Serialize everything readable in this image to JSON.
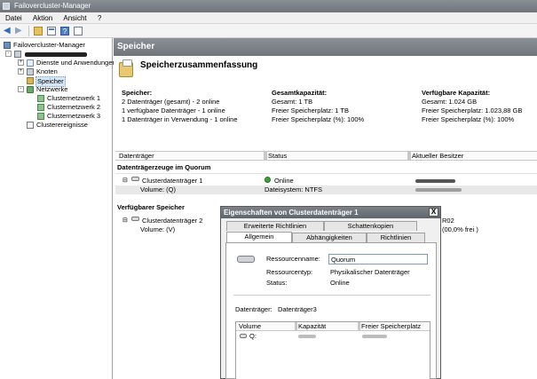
{
  "window": {
    "title": "Failovercluster-Manager"
  },
  "menu": [
    "Datei",
    "Aktion",
    "Ansicht",
    "?"
  ],
  "tree": {
    "root": "Failovercluster-Manager",
    "items": [
      {
        "label": "Dienste und Anwendungen"
      },
      {
        "label": "Knoten"
      },
      {
        "label": "Speicher"
      },
      {
        "label": "Netzwerke"
      },
      {
        "label": "Clusternetzwerk 1"
      },
      {
        "label": "Clusternetzwerk 2"
      },
      {
        "label": "Clusternetzwerk 3"
      },
      {
        "label": "Clusterereignisse"
      }
    ]
  },
  "main": {
    "header": "Speicher",
    "summary_title": "Speicherzusammenfassung",
    "speicher": {
      "heading": "Speicher:",
      "lines": [
        "2 Datenträger (gesamt) - 2 online",
        "1 verfügbare Datenträger - 1 online",
        "1 Datenträger in Verwendung - 1 online"
      ]
    },
    "gesamt": {
      "heading": "Gesamtkapazität:",
      "lines": [
        "Gesamt: 1 TB",
        "Freier Speicherplatz: 1 TB",
        "Freier Speicherplatz (%): 100%"
      ]
    },
    "verfuegbar": {
      "heading": "Verfügbare Kapazität:",
      "lines": [
        "Gesamt: 1.024 GB",
        "Freier Speicherplatz: 1.023,88 GB",
        "Freier Speicherplatz (%): 100%"
      ]
    },
    "columns": [
      "Datenträger",
      "Status",
      "Aktueller Besitzer"
    ],
    "group1": "Datenträgerzeuge im Quorum",
    "disk1": {
      "name": "Clusterdatenträger 1",
      "status": "Online",
      "volume": "Volume: (Q)",
      "fs": "Dateisystem: NTFS"
    },
    "group2": "Verfügbarer Speicher",
    "disk2": {
      "name": "Clusterdatenträger 2",
      "volume": "Volume: (V)",
      "owner_tail": "R02",
      "free_tail": "(00,0% frei )"
    }
  },
  "dialog": {
    "title": "Eigenschaften von Clusterdatenträger 1",
    "close": "X",
    "tabs_back": [
      "Erweiterte Richtlinien",
      "Schattenkopien"
    ],
    "tabs_front": [
      "Allgemein",
      "Abhängigkeiten",
      "Richtlinien"
    ],
    "resource_name_label": "Ressourcenname:",
    "resource_name_value": "Quorum",
    "resource_type_label": "Ressourcentyp:",
    "resource_type_value": "Physikalischer Datenträger",
    "status_label": "Status:",
    "status_value": "Online",
    "disk_label": "Datenträger:",
    "disk_value": "Datenträger3",
    "table_columns": [
      "Volume",
      "Kapazität",
      "Freier Speicherplatz"
    ],
    "row_volume": "Q:"
  }
}
